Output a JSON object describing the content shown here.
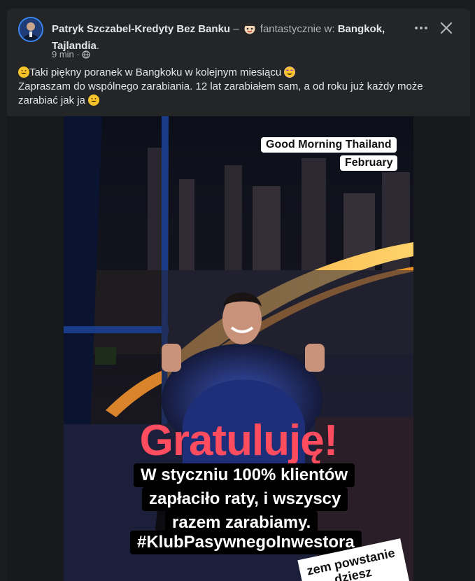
{
  "post": {
    "author": "Patryk Szczabel-Kredyty Bez Banku",
    "dash": " – ",
    "feeling": "fantastycznie w: ",
    "location": "Bangkok, Tajlandia",
    "period": ".",
    "time": "9 min",
    "text_line1": "Taki piękny poranek w Bangkoku w kolejnym miesiącu",
    "text_line2": "Zapraszam do wspólnego zarabiania. 12 lat zarabiałem sam, a od roku już każdy może zarabiać jak ja"
  },
  "image": {
    "label_line1": "Good Morning Thailand",
    "label_line2": "February",
    "headline": "Gratuluję!",
    "line1": "W styczniu 100% klientów",
    "line2": "zapłaciło raty, i wszyscy",
    "line3": "razem zarabiamy.",
    "line4": "#KlubPasywnegoInwestora",
    "sticker_line1": "zem powstanie",
    "sticker_line2": "dziesz"
  },
  "icons": {
    "more": "more-horizontal-icon",
    "close": "close-icon",
    "globe": "globe-icon"
  },
  "colors": {
    "accent_red": "#ff4c5f",
    "card_bg": "#242526"
  }
}
